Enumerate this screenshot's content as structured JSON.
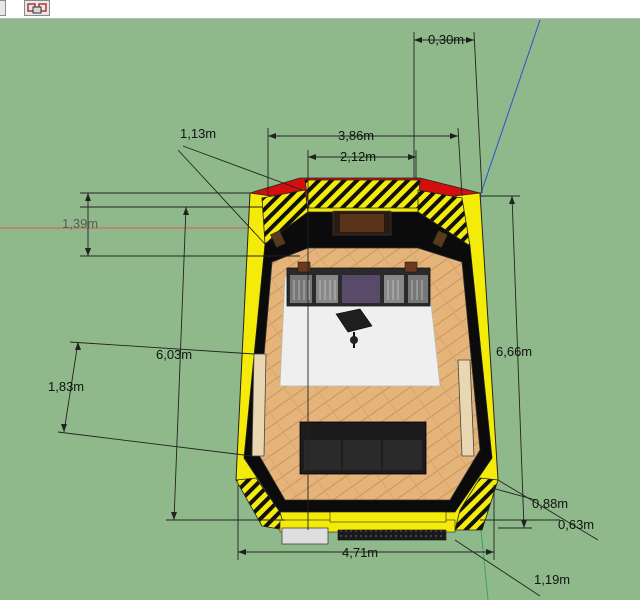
{
  "viewport": {
    "background": "#8fb98a",
    "axis_blue": "#2a4fd8",
    "axis_red": "#d85a4a",
    "axis_green": "#3ca55c"
  },
  "toolbar": {
    "buttons": [
      {
        "icon": "camera-icon"
      },
      {
        "icon": "section-icon"
      }
    ]
  },
  "dimensions": {
    "d_030": "0,30m",
    "d_113": "1,13m",
    "d_386": "3,86m",
    "d_212": "2,12m",
    "d_139": "1,39m",
    "d_603": "6,03m",
    "d_666": "6,66m",
    "d_183": "1,83m",
    "d_088": "0,88m",
    "d_063": "0,63m",
    "d_471": "4,71m",
    "d_119": "1,19m"
  },
  "colors": {
    "wall_yellow": "#f4ec08",
    "wall_red": "#d40d0d",
    "floor_wood": "#e5b47a",
    "carpet": "#efefef",
    "wall_black": "#0b0b0b",
    "couch": "#1c1c1c"
  }
}
